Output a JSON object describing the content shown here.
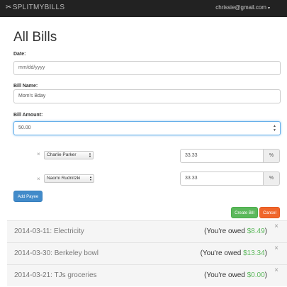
{
  "navbar": {
    "brand_icon": "✂",
    "brand": "SPLITMYBILLS",
    "user_email": "chrissie@gmail.com",
    "caret": "▾"
  },
  "page": {
    "title": "All Bills"
  },
  "form": {
    "date": {
      "label": "Date:",
      "value": "mm/dd/yyyy"
    },
    "bill_name": {
      "label": "Bill Name:",
      "value": "Mom's Bday"
    },
    "bill_amount": {
      "label": "Bill Amount:",
      "value": "50.00"
    },
    "payees": [
      {
        "remove": "×",
        "name": "Charlie Parker",
        "percent": "33.33",
        "unit": "%"
      },
      {
        "remove": "×",
        "name": "Naomi Rudnitzki",
        "percent": "33.33",
        "unit": "%"
      }
    ],
    "add_payee_label": "Add Payee",
    "create_bill_label": "Create Bill",
    "cancel_label": "Cancel"
  },
  "bills": [
    {
      "title": "2014-03-11: Electricity",
      "owed_prefix": "(You're owed ",
      "amount": "$8.49",
      "owed_suffix": ")",
      "close": "×"
    },
    {
      "title": "2014-03-30: Berkeley bowl",
      "owed_prefix": "(You're owed ",
      "amount": "$13.34",
      "owed_suffix": ")",
      "close": "×"
    },
    {
      "title": "2014-03-21: TJs groceries",
      "owed_prefix": "(You're owed ",
      "amount": "$0.00",
      "owed_suffix": ")",
      "close": "×"
    }
  ],
  "colors": {
    "navbar": "#222222",
    "primary": "#428bca",
    "success": "#5cb85c",
    "danger": "#f0662b"
  },
  "icons": {
    "brand": "scissors-icon",
    "remove": "close-icon",
    "dropdown": "chevron-down-icon"
  }
}
